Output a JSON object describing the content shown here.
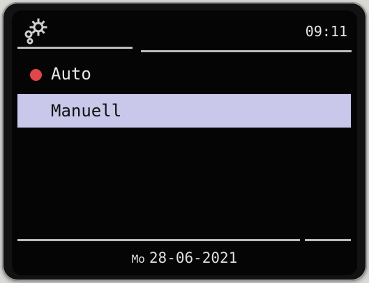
{
  "status_bar": {
    "icon": "gear-icon",
    "time": "09:11"
  },
  "menu": {
    "items": [
      {
        "label": "Auto",
        "selected": true,
        "highlighted": false,
        "indicator_color": "#e0474c"
      },
      {
        "label": "Manuell",
        "selected": false,
        "highlighted": true,
        "highlight_color": "#c9c8ea"
      }
    ]
  },
  "footer": {
    "day": "Mo",
    "date": "28-06-2021"
  }
}
